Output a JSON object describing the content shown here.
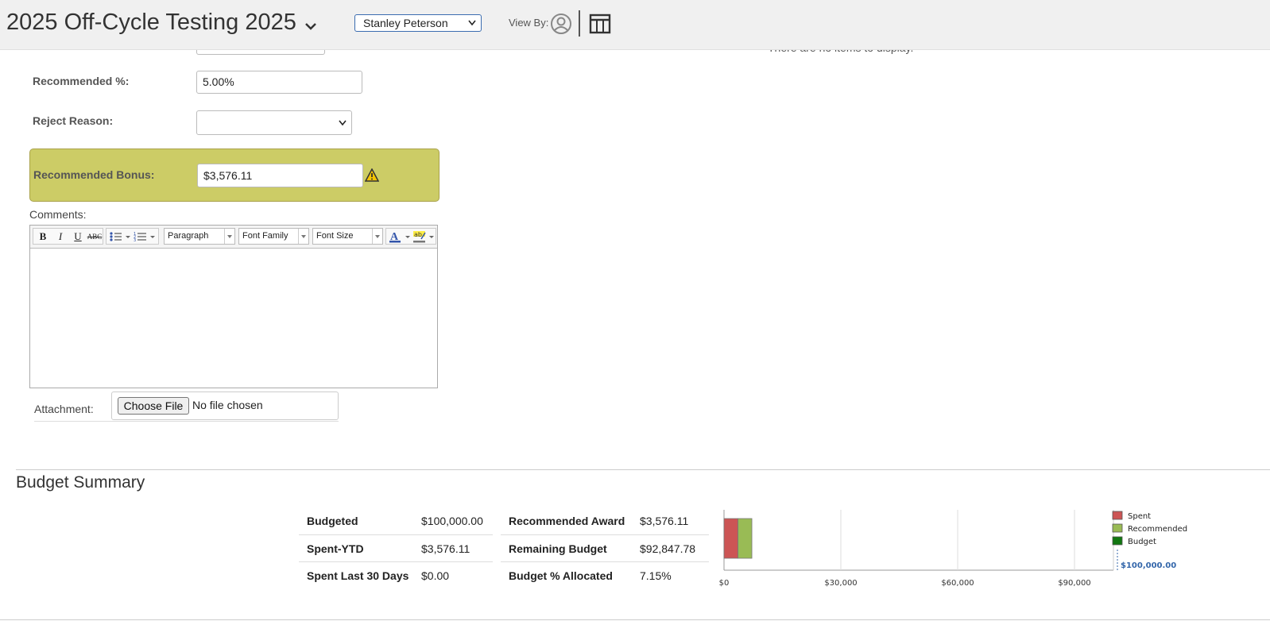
{
  "header": {
    "title": "2025 Off-Cycle Testing 2025",
    "employee_select": "Stanley Peterson",
    "view_by_label": "View By:"
  },
  "side_panel": {
    "empty_message": "There are no items to display."
  },
  "form": {
    "recommended_pct_label": "Recommended %:",
    "recommended_pct_value": "5.00%",
    "reject_reason_label": "Reject Reason:",
    "reject_reason_value": "",
    "recommended_bonus_label": "Recommended Bonus:",
    "recommended_bonus_value": "$3,576.11",
    "comments_label": "Comments:",
    "attachment_label": "Attachment:",
    "choose_file_label": "Choose File",
    "no_file_text": "No file chosen"
  },
  "editor": {
    "buttons": [
      "B",
      "I",
      "U",
      "ABC"
    ],
    "paragraph": "Paragraph",
    "font_family": "Font Family",
    "font_size": "Font Size"
  },
  "budget_summary": {
    "title": "Budget Summary",
    "left": [
      {
        "label": "Budgeted",
        "value": "$100,000.00"
      },
      {
        "label": "Spent-YTD",
        "value": "$3,576.11"
      },
      {
        "label": "Spent Last 30 Days",
        "value": "$0.00"
      }
    ],
    "right": [
      {
        "label": "Recommended Award",
        "value": "$3,576.11"
      },
      {
        "label": "Remaining Budget",
        "value": "$92,847.78"
      },
      {
        "label": "Budget % Allocated",
        "value": "7.15%"
      }
    ]
  },
  "chart_data": {
    "type": "bar",
    "orientation": "horizontal-stacked",
    "series": [
      {
        "name": "Spent",
        "value": 3576.11,
        "color": "#cc5555"
      },
      {
        "name": "Recommended",
        "value": 3576.11,
        "color": "#99bb55"
      },
      {
        "name": "Budget",
        "value": 100000,
        "color": "#117711"
      }
    ],
    "budget_label": "$100,000.00",
    "ticks": [
      "$0",
      "$30,000",
      "$60,000",
      "$90,000"
    ],
    "tick_values": [
      0,
      30000,
      60000,
      90000
    ],
    "xlim": [
      0,
      100000
    ],
    "legend_position": "right",
    "grid": true
  }
}
